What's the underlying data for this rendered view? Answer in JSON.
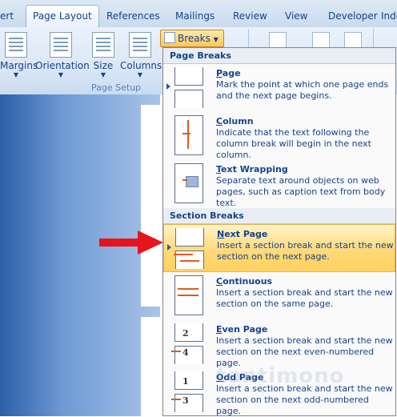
{
  "tabs": [
    "ert",
    "Page Layout",
    "References",
    "Mailings",
    "Review",
    "View",
    "Developer"
  ],
  "ribbon": {
    "buttons": [
      "Margins",
      "Orientation",
      "Size",
      "Columns"
    ],
    "group_label": "Page Setup",
    "breaks_label": "Breaks",
    "right_clip": "Inde"
  },
  "menu": {
    "page_breaks_header": "Page Breaks",
    "section_breaks_header": "Section Breaks",
    "items": [
      {
        "title": "Page",
        "mnemonic": "P",
        "rest": "age",
        "desc": "Mark the point at which one page ends and the next page begins."
      },
      {
        "title": "Column",
        "mnemonic": "C",
        "rest": "olumn",
        "desc": "Indicate that the text following the column break will begin in the next column."
      },
      {
        "title": "Text Wrapping",
        "mnemonic": "T",
        "rest": "ext Wrapping",
        "desc": "Separate text around objects on web pages, such as caption text from body text."
      },
      {
        "title": "Next Page",
        "mnemonic": "N",
        "rest": "ext Page",
        "desc": "Insert a section break and start the new section on the next page."
      },
      {
        "title": "Continuous",
        "mnemonic": "C",
        "rest": "ontinuous",
        "desc": "Insert a section break and start the new section on the same page."
      },
      {
        "title": "Even Page",
        "mnemonic": "E",
        "rest": "ven Page",
        "desc": "Insert a section break and start the new section on the next even-numbered page."
      },
      {
        "title": "Odd Page",
        "mnemonic": "O",
        "rest": "dd Page",
        "desc": "Insert a section break and start the new section on the next odd-numbered page."
      }
    ],
    "even_numbers": [
      "2",
      "4"
    ],
    "odd_numbers": [
      "1",
      "3"
    ]
  },
  "watermark": "tontimono",
  "colors": {
    "highlight": "#ffd97a",
    "arrow": "#e8141b",
    "text": "#15428b"
  }
}
